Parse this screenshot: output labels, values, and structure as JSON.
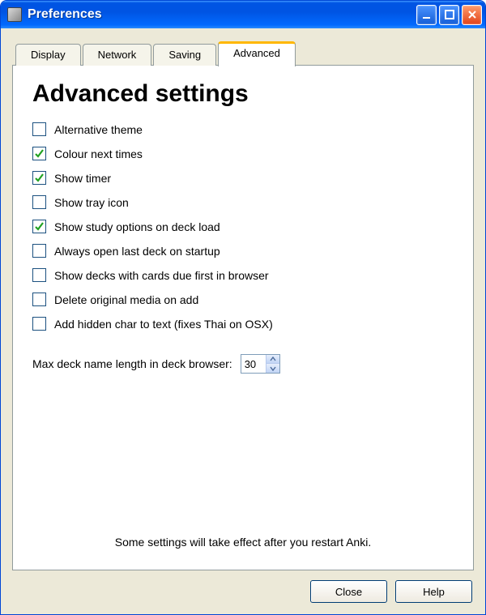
{
  "window": {
    "title": "Preferences"
  },
  "tabs": [
    {
      "label": "Display"
    },
    {
      "label": "Network"
    },
    {
      "label": "Saving"
    },
    {
      "label": "Advanced"
    }
  ],
  "heading": "Advanced settings",
  "options": [
    {
      "label": "Alternative theme",
      "checked": false
    },
    {
      "label": "Colour next times",
      "checked": true
    },
    {
      "label": "Show timer",
      "checked": true
    },
    {
      "label": "Show tray icon",
      "checked": false
    },
    {
      "label": "Show study options on deck load",
      "checked": true
    },
    {
      "label": "Always open last deck on startup",
      "checked": false
    },
    {
      "label": "Show decks with cards due first in browser",
      "checked": false
    },
    {
      "label": "Delete original media on add",
      "checked": false
    },
    {
      "label": "Add hidden char to text (fixes Thai on OSX)",
      "checked": false
    }
  ],
  "spin": {
    "label": "Max deck name length in deck browser:",
    "value": "30"
  },
  "note": "Some settings will take effect after you restart Anki.",
  "buttons": {
    "close": "Close",
    "help": "Help"
  }
}
